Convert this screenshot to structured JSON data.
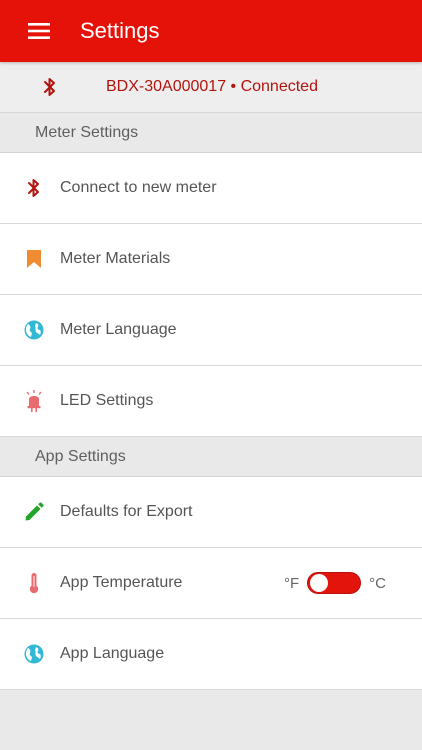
{
  "appbar": {
    "title": "Settings",
    "menu_icon": "hamburger-menu-icon",
    "color": "#e5120a"
  },
  "connection": {
    "icon": "bluetooth-icon",
    "text": "BDX-30A000017 • Connected",
    "color": "#b3140e"
  },
  "meter_settings": {
    "header": "Meter Settings",
    "items": [
      {
        "label": "Connect to new meter",
        "icon": "bluetooth-icon"
      },
      {
        "label": "Meter Materials",
        "icon": "bookmark-icon"
      },
      {
        "label": "Meter Language",
        "icon": "globe-icon"
      },
      {
        "label": "LED Settings",
        "icon": "led-icon"
      }
    ]
  },
  "app_settings": {
    "header": "App Settings",
    "items": [
      {
        "label": "Defaults for Export",
        "icon": "pencil-icon"
      },
      {
        "label": "App Temperature",
        "icon": "thermometer-icon"
      },
      {
        "label": "App Language",
        "icon": "globe-icon"
      }
    ],
    "temperature_toggle": {
      "left_label": "°F",
      "right_label": "°C",
      "selected": "°F"
    }
  }
}
